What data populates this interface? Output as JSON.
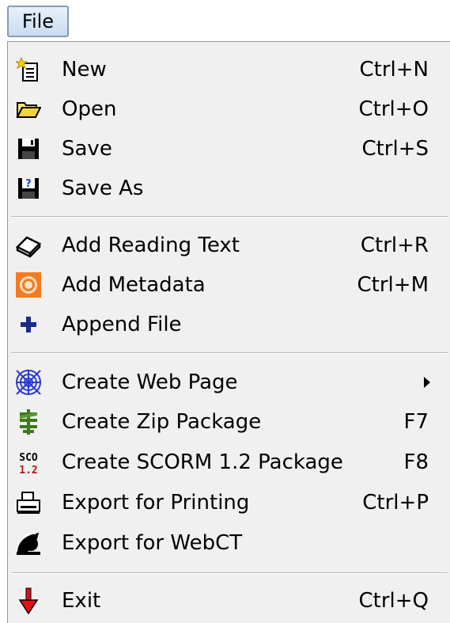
{
  "menubar": {
    "file_label": "File"
  },
  "menu": {
    "items": [
      {
        "label": "New",
        "shortcut": "Ctrl+N",
        "icon": "new-document-icon"
      },
      {
        "label": "Open",
        "shortcut": "Ctrl+O",
        "icon": "open-folder-icon"
      },
      {
        "label": "Save",
        "shortcut": "Ctrl+S",
        "icon": "floppy-disk-icon"
      },
      {
        "label": "Save As",
        "shortcut": "",
        "icon": "floppy-question-icon"
      },
      {
        "label": "Add Reading Text",
        "shortcut": "Ctrl+R",
        "icon": "book-icon"
      },
      {
        "label": "Add Metadata",
        "shortcut": "Ctrl+M",
        "icon": "metadata-icon"
      },
      {
        "label": "Append File",
        "shortcut": "",
        "icon": "plus-icon"
      },
      {
        "label": "Create Web Page",
        "shortcut": "",
        "icon": "web-icon",
        "submenu": true
      },
      {
        "label": "Create Zip Package",
        "shortcut": "F7",
        "icon": "zip-icon"
      },
      {
        "label": "Create SCORM 1.2 Package",
        "shortcut": "F8",
        "icon": "scorm-icon"
      },
      {
        "label": "Export for Printing",
        "shortcut": "Ctrl+P",
        "icon": "printer-icon"
      },
      {
        "label": "Export for WebCT",
        "shortcut": "",
        "icon": "webct-icon"
      },
      {
        "label": "Exit",
        "shortcut": "Ctrl+Q",
        "icon": "exit-arrow-icon"
      }
    ],
    "scorm_icon_text": {
      "top": "SCO",
      "bottom": "1.2"
    }
  },
  "colors": {
    "menu_bg": "#f0f0f0",
    "metadata_orange": "#f47b20",
    "exit_red": "#e0101a",
    "zip_green": "#3c7a1a",
    "plus_blue": "#1b2a8a"
  }
}
